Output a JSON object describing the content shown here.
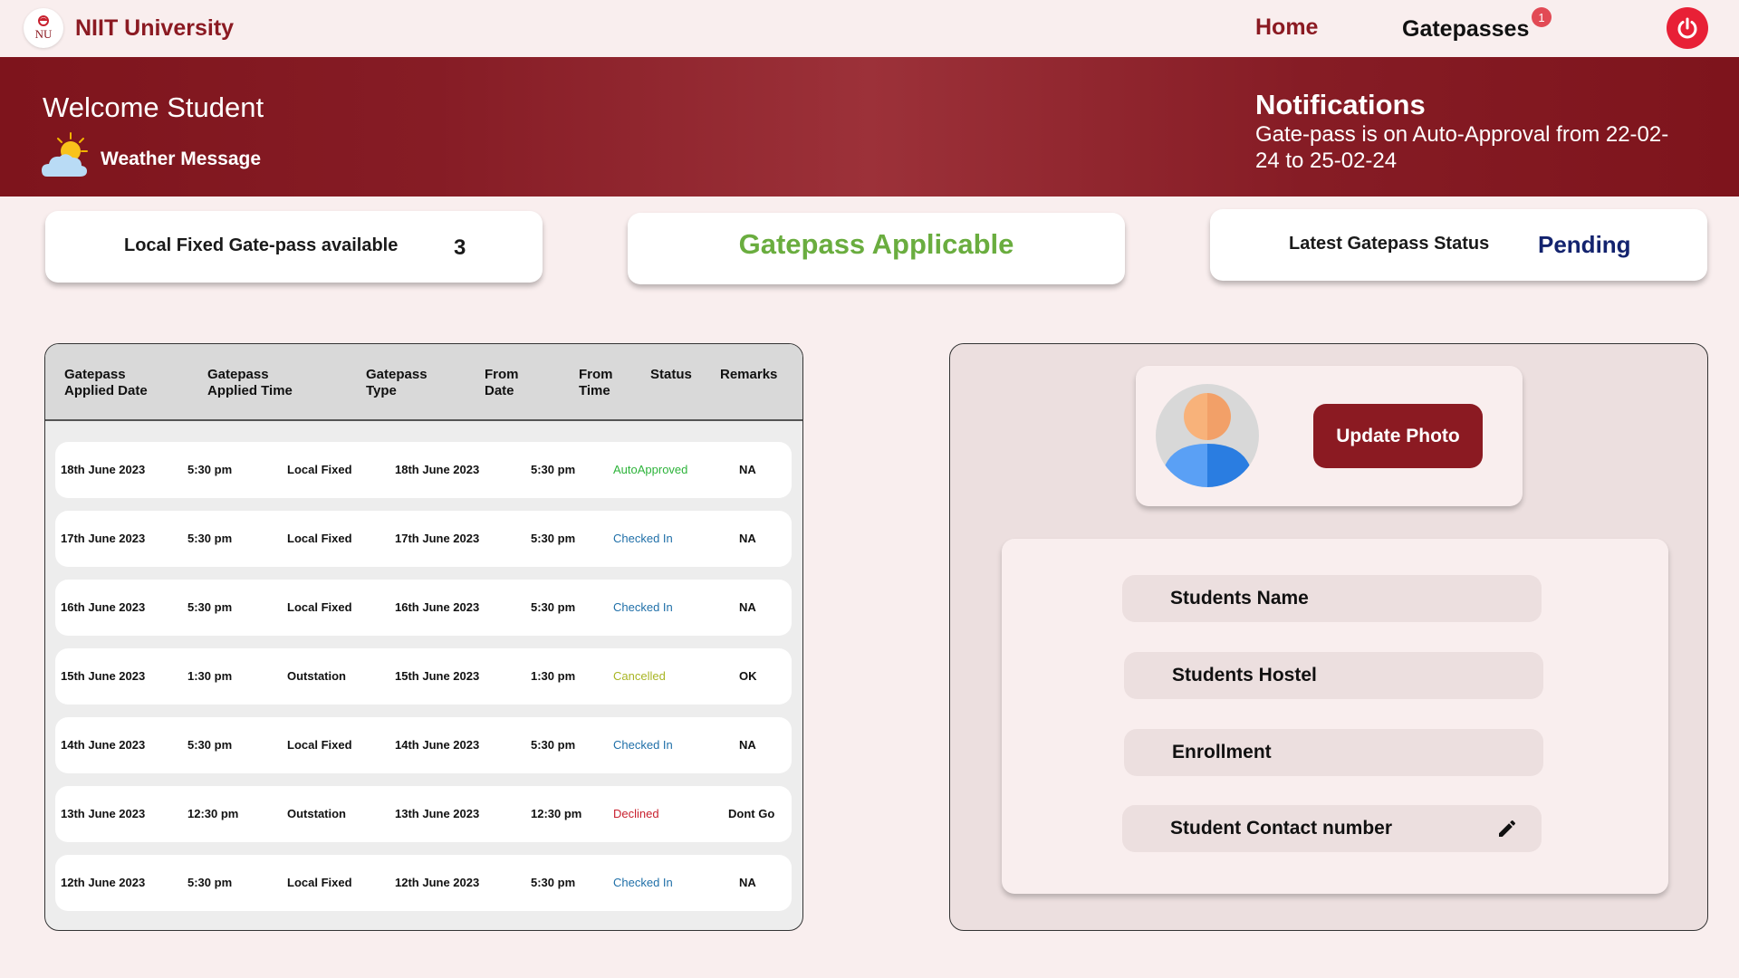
{
  "nav": {
    "brand": "NIIT University",
    "logo_text": "NU",
    "home": "Home",
    "gatepasses": "Gatepasses",
    "gatepasses_badge": "1"
  },
  "banner": {
    "welcome": "Welcome Student",
    "weather_message": "Weather Message",
    "notifications_title": "Notifications",
    "notifications_body": "Gate-pass is on Auto-Approval from 22-02-24 to 25-02-24"
  },
  "cards": {
    "local_fixed_label": "Local Fixed Gate-pass available",
    "local_fixed_value": "3",
    "applicable_label": "Gatepass Applicable",
    "latest_status_label": "Latest Gatepass Status",
    "latest_status_value": "Pending"
  },
  "table": {
    "headers": [
      [
        "Gatepass",
        "Applied Date"
      ],
      [
        "Gatepass",
        "Applied Time"
      ],
      [
        "Gatepass",
        "Type"
      ],
      [
        "From",
        "Date"
      ],
      [
        "From",
        "Time"
      ],
      [
        "Status",
        ""
      ],
      [
        "Remarks",
        ""
      ]
    ],
    "rows": [
      {
        "applied_date": "18th June 2023",
        "applied_time": "5:30 pm",
        "type": "Local Fixed",
        "from_date": "18th June 2023",
        "from_time": "5:30 pm",
        "status": "AutoApproved",
        "remarks": "NA"
      },
      {
        "applied_date": "17th June 2023",
        "applied_time": "5:30 pm",
        "type": "Local Fixed",
        "from_date": "17th June 2023",
        "from_time": "5:30 pm",
        "status": "Checked In",
        "remarks": "NA"
      },
      {
        "applied_date": "16th June 2023",
        "applied_time": "5:30 pm",
        "type": "Local Fixed",
        "from_date": "16th June 2023",
        "from_time": "5:30 pm",
        "status": "Checked In",
        "remarks": "NA"
      },
      {
        "applied_date": "15th June 2023",
        "applied_time": "1:30 pm",
        "type": "Outstation",
        "from_date": "15th June 2023",
        "from_time": "1:30 pm",
        "status": "Cancelled",
        "remarks": "OK"
      },
      {
        "applied_date": "14th June 2023",
        "applied_time": "5:30 pm",
        "type": "Local Fixed",
        "from_date": "14th June 2023",
        "from_time": "5:30 pm",
        "status": "Checked In",
        "remarks": "NA"
      },
      {
        "applied_date": "13th June 2023",
        "applied_time": "12:30 pm",
        "type": "Outstation",
        "from_date": "13th June 2023",
        "from_time": "12:30 pm",
        "status": "Declined",
        "remarks": "Dont Go"
      },
      {
        "applied_date": "12th June 2023",
        "applied_time": "5:30 pm",
        "type": "Local Fixed",
        "from_date": "12th June 2023",
        "from_time": "5:30 pm",
        "status": "Checked In",
        "remarks": "NA"
      }
    ]
  },
  "status_colors": {
    "AutoApproved": "#2db33a",
    "Checked In": "#1f6fa8",
    "Cancelled": "#a8b524",
    "Declined": "#c8202e"
  },
  "profile": {
    "update_photo": "Update Photo",
    "fields": [
      "Students Name",
      "Students Hostel",
      "Enrollment",
      "Student Contact number"
    ]
  },
  "icons": {
    "power": "power-icon",
    "weather": "sun-cloud-icon",
    "avatar": "user-avatar-icon",
    "edit": "pencil-icon"
  },
  "colors": {
    "brand": "#8b1a22",
    "applicable": "#6aad3f",
    "pending": "#13236e",
    "power": "#e82036"
  }
}
